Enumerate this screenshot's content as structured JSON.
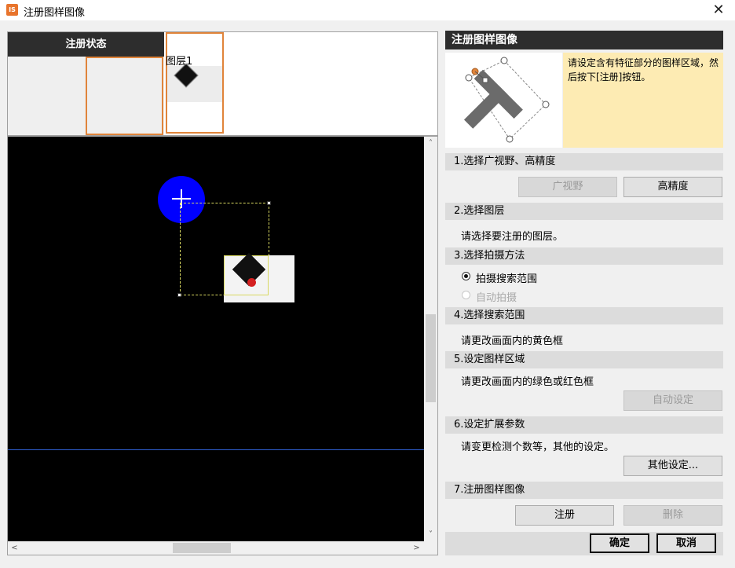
{
  "window": {
    "title": "注册图样图像",
    "close_glyph": "✕",
    "icon_text": "IS"
  },
  "left_panel": {
    "status_header": "注册状态",
    "layer_label": "图层1",
    "scroll": {
      "up": "˄",
      "down": "˅",
      "left": "<",
      "right": ">"
    }
  },
  "right_panel": {
    "header": "注册图样图像",
    "note": "请设定含有特征部分的图样区域，然后按下[注册]按钮。",
    "sections": {
      "s1": {
        "title": "1.选择广视野、高精度",
        "btn_wide": "广视野",
        "btn_high": "高精度"
      },
      "s2": {
        "title": "2.选择图层",
        "desc": "请选择要注册的图层。"
      },
      "s3": {
        "title": "3.选择拍摄方法",
        "opt1": "拍摄搜索范围",
        "opt2": "自动拍摄"
      },
      "s4": {
        "title": "4.选择搜索范围",
        "desc": "请更改画面内的黄色框"
      },
      "s5": {
        "title": "5.设定图样区域",
        "desc": "请更改画面内的绿色或红色框",
        "btn": "自动设定"
      },
      "s6": {
        "title": "6.设定扩展参数",
        "desc": "请变更检测个数等，其他的设定。",
        "btn": "其他设定..."
      },
      "s7": {
        "title": "7.注册图样图像",
        "btn_register": "注册",
        "btn_delete": "删除"
      }
    },
    "footer": {
      "ok": "确定",
      "cancel": "取消"
    }
  },
  "colors": {
    "accent_orange": "#e0843a",
    "header_dark": "#2d2d2d",
    "note_bg": "#fdebb3",
    "circle_blue": "#0000ff"
  }
}
